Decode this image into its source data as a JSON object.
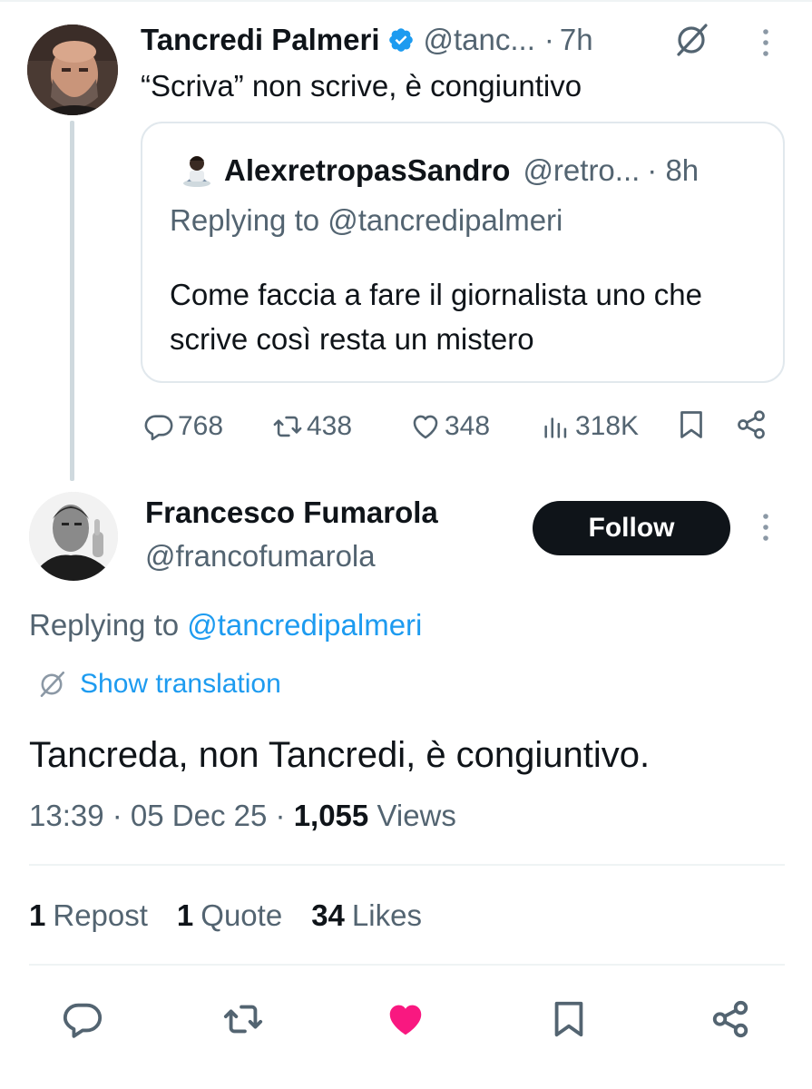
{
  "parent_tweet": {
    "author_name": "Tancredi Palmeri",
    "handle": "@tanc...",
    "separator": "·",
    "time": "7h",
    "text": "“Scriva” non scrive, è congiuntivo",
    "quoted": {
      "author_name": "AlexretropasSandro",
      "handle": "@retro...",
      "time": "· 8h",
      "replying_to": "Replying to @tancredipalmeri",
      "text": "Come faccia a fare il giornalista uno che scrive così resta un mistero"
    },
    "metrics": {
      "replies": "768",
      "reposts": "438",
      "likes": "348",
      "views": "318K"
    }
  },
  "main_tweet": {
    "author_name": "Francesco Fumarola",
    "handle": "@francofumarola",
    "follow_label": "Follow",
    "replying_prefix": "Replying to ",
    "replying_handle": "@tancredipalmeri",
    "translate_label": "Show translation",
    "text": "Tancreda, non Tancredi, è congiuntivo.",
    "time": "13:39",
    "date": "05 Dec 25",
    "views_count": "1,055",
    "views_label": "Views",
    "stats": {
      "reposts_count": "1",
      "reposts_label": "Repost",
      "quotes_count": "1",
      "quotes_label": "Quote",
      "likes_count": "34",
      "likes_label": "Likes"
    }
  },
  "icons": {
    "verified": "verified-badge-icon",
    "grok": "grok-icon",
    "more": "more-vertical-icon",
    "reply": "reply-icon",
    "repost": "repost-icon",
    "like": "heart-icon",
    "views": "views-icon",
    "bookmark": "bookmark-icon",
    "share": "share-icon",
    "translate": "translate-icon"
  },
  "colors": {
    "accent": "#1d9bf0",
    "like_active": "#f91880",
    "text_primary": "#0f1419",
    "text_secondary": "#536471"
  }
}
